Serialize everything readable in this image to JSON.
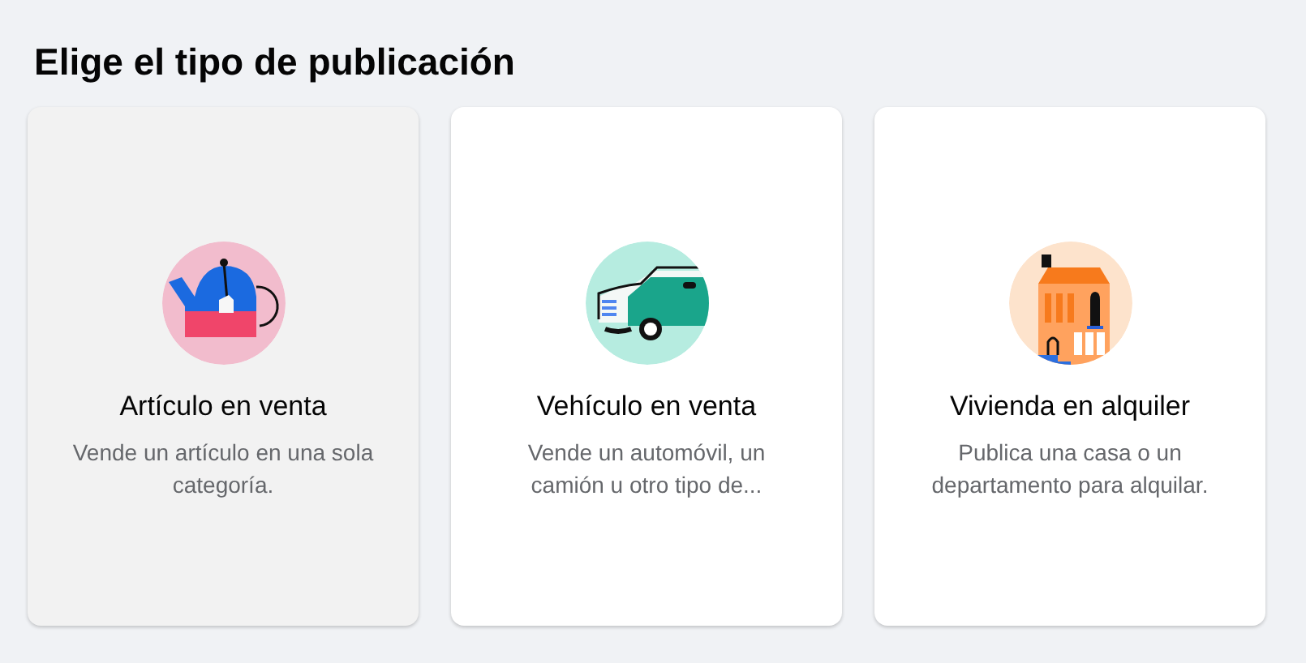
{
  "title": "Elige el tipo de publicación",
  "cards": [
    {
      "kind": "item",
      "title": "Artículo en venta",
      "description": "Vende un artículo en una sola categoría.",
      "selected": true
    },
    {
      "kind": "vehicle",
      "title": "Vehículo en venta",
      "description": "Vende un automóvil, un camión u otro tipo de...",
      "selected": false
    },
    {
      "kind": "home",
      "title": "Vivienda en alquiler",
      "description": "Publica una casa o un departamento para alquilar.",
      "selected": false
    }
  ]
}
